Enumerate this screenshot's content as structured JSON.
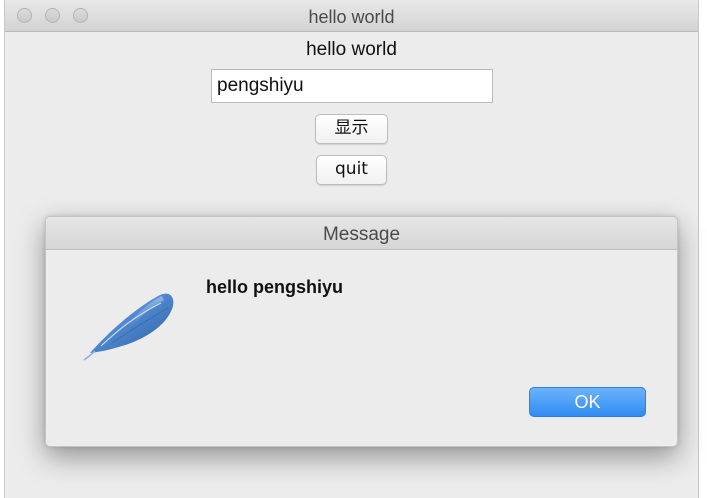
{
  "window": {
    "title": "hello world"
  },
  "main": {
    "label": "hello world",
    "name_input": {
      "value": "pengshiyu"
    },
    "show_button": "显示",
    "quit_button": "quit"
  },
  "dialog": {
    "title": "Message",
    "message": "hello pengshiyu",
    "icon": "feather-icon",
    "ok_button": "OK",
    "accent_color": "#3d94f6"
  }
}
